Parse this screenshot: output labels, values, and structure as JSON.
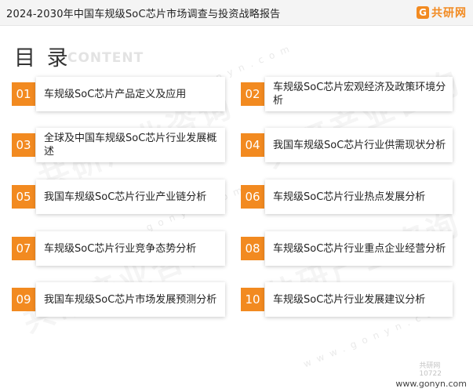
{
  "header": {
    "title": "2024-2030年中国车规级SoC芯片市场调查与投资战略报告",
    "logo_mark": "G",
    "logo_text": "共研网"
  },
  "toc": {
    "title": "目 录",
    "subtitle": "CONTENT"
  },
  "watermark": {
    "text": "共研产业咨询",
    "url": "www.gonyn.com"
  },
  "items": [
    {
      "num": "01",
      "label": "车规级SoC芯片产品定义及应用"
    },
    {
      "num": "02",
      "label": "车规级SoC芯片宏观经济及政策环境分析"
    },
    {
      "num": "03",
      "label": "全球及中国车规级SoC芯片行业发展概述"
    },
    {
      "num": "04",
      "label": "我国车规级SoC芯片行业供需现状分析"
    },
    {
      "num": "05",
      "label": "我国车规级SoC芯片行业产业链分析"
    },
    {
      "num": "06",
      "label": "车规级SoC芯片行业热点发展分析"
    },
    {
      "num": "07",
      "label": "车规级SoC芯片行业竞争态势分析"
    },
    {
      "num": "08",
      "label": "车规级SoC芯片行业重点企业经营分析"
    },
    {
      "num": "09",
      "label": "我国车规级SoC芯片市场发展预测分析"
    },
    {
      "num": "10",
      "label": "车规级SoC芯片行业发展建议分析"
    }
  ],
  "footer": {
    "url": "www.gonyn.com",
    "stamp_line1": "共研网",
    "stamp_line2": "10722"
  },
  "colors": {
    "accent": "#f28a20",
    "header_bg": "#f4f4f4"
  }
}
